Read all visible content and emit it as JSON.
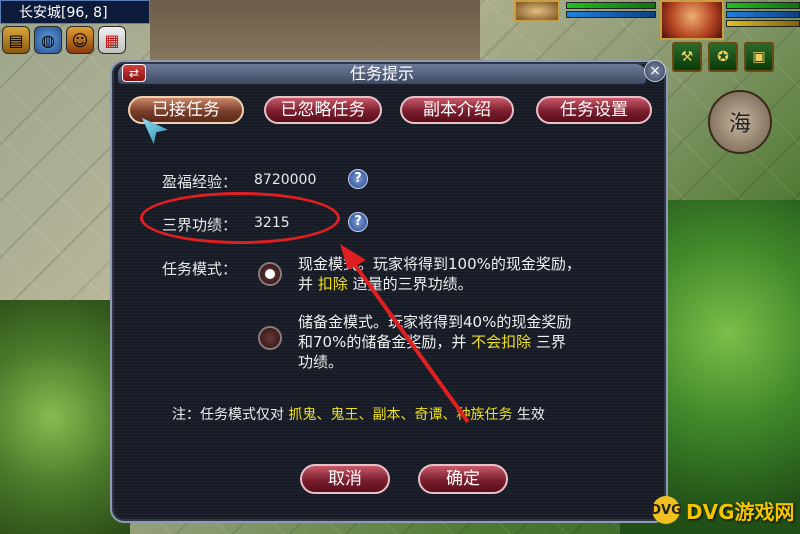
{
  "hud": {
    "location": "长安城[96, 8]",
    "icons": [
      "book-icon",
      "globe-icon",
      "person-icon",
      "calendar-icon"
    ],
    "right_buttons": [
      "bag-icon",
      "tool-icon",
      "treasure-icon"
    ],
    "round_button_label": "海"
  },
  "dialog": {
    "title": "任务提示",
    "swap_symbol": "⇄",
    "close_symbol": "×",
    "tabs": [
      {
        "label": "已接任务",
        "active": true
      },
      {
        "label": "已忽略任务",
        "active": false
      },
      {
        "label": "副本介绍",
        "active": false
      },
      {
        "label": "任务设置",
        "active": false
      }
    ],
    "stats": {
      "exp_label": "盈福经验：",
      "exp_value": "8720000",
      "merit_label": "三界功绩：",
      "merit_value": "3215",
      "help_symbol": "?"
    },
    "mode_label": "任务模式：",
    "modes": [
      {
        "selected": true,
        "line1": "现金模式。玩家将得到100%的现金奖励，",
        "line2_prefix": "并",
        "line2_highlight": "扣除",
        "line2_suffix": "适量的三界功绩。"
      },
      {
        "selected": false,
        "line1": "储备金模式。玩家将得到40%的现金奖励",
        "line2_prefix": "和70%的储备金奖励，并",
        "line2_highlight": "不会扣除",
        "line2_suffix": "三界",
        "line3": "功绩。"
      }
    ],
    "note": {
      "prefix": "注：任务模式仅对",
      "highlight": "抓鬼、鬼王、副本、奇谭、种族任务",
      "suffix": "生效"
    },
    "buttons": {
      "cancel": "取消",
      "confirm": "确定"
    }
  },
  "annotation": {
    "color": "#e02020"
  },
  "watermark": {
    "logo": "DVG",
    "text": "DVG游戏网"
  },
  "colors": {
    "panel_bg": "#161b26",
    "tab_red": "#7a1e2e",
    "highlight_yellow": "#f0e020"
  }
}
